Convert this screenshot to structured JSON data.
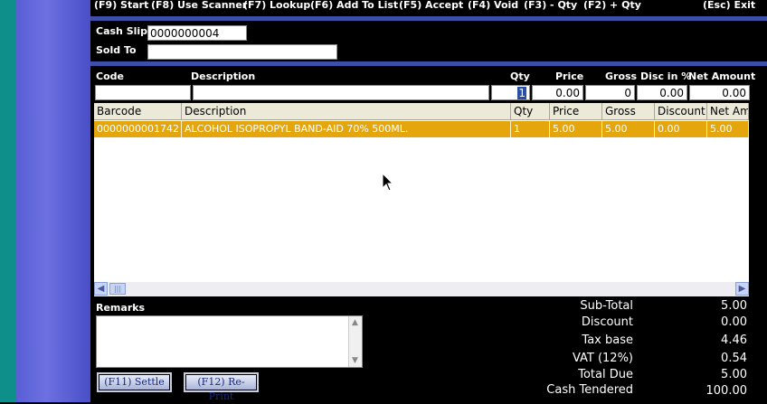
{
  "shortcuts": [
    "(F9) Start",
    "(F8) Use Scanner",
    "(F7) Lookup",
    "(F6) Add To List",
    "(F5) Accept",
    "(F4) Void",
    "(F3) - Qty",
    "(F2) + Qty",
    "(Esc) Exit"
  ],
  "header": {
    "cash_slip_label": "Cash Slip",
    "cash_slip_value": "0000000004",
    "sold_to_label": "Sold To",
    "sold_to_value": ""
  },
  "entry": {
    "labels": {
      "code": "Code",
      "description": "Description",
      "qty": "Qty",
      "price": "Price",
      "gross": "Gross",
      "disc": "Disc in %",
      "net": "Net Amount"
    },
    "values": {
      "code": "",
      "description": "",
      "qty": "1",
      "price": "0.00",
      "gross": "0",
      "disc": "0.00",
      "net": "0.00"
    }
  },
  "grid": {
    "columns": [
      "Barcode",
      "Description",
      "Qty",
      "Price",
      "Gross",
      "Discount",
      "Net Am"
    ],
    "rows": [
      [
        "0000000001742",
        "ALCOHOL ISOPROPYL BAND-AID 70% 500ML.",
        "1",
        "5.00",
        "5.00",
        "0.00",
        "5.00"
      ]
    ],
    "row_color": "#e4a60c"
  },
  "remarks_label": "Remarks",
  "buttons": {
    "settle": "(F11) Settle",
    "reprint": "(F12) Re-Print"
  },
  "totals": {
    "subtotal_label": "Sub-Total",
    "subtotal": "5.00",
    "discount_label": "Discount",
    "discount": "0.00",
    "taxbase_label": "Tax base",
    "taxbase": "4.46",
    "vat_label": "VAT (12%)",
    "vat": "0.54",
    "totaldue_label": "Total Due",
    "totaldue": "5.00",
    "tendered_label": "Cash Tendered",
    "tendered": "100.00"
  },
  "colors": {
    "accent_bar": "#3d4fa8",
    "sidebar": "#5a5fd6",
    "teal": "#0e8f8a"
  }
}
